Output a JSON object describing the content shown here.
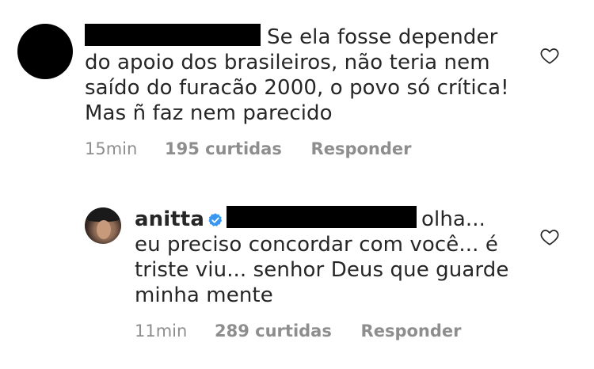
{
  "comments": [
    {
      "text_line1": "Se ela fosse depender",
      "text_line2": "do apoio dos brasileiros, não teria nem",
      "text_line3": "saído do furacão 2000, o povo só crítica!",
      "text_line4": "Mas ñ faz nem parecido",
      "time": "15min",
      "likes": "195 curtidas",
      "reply_label": "Responder",
      "avatar_icon": "redacted-avatar",
      "like_icon": "heart-outline-icon"
    },
    {
      "username": "anitta",
      "verified_icon": "verified-badge-icon",
      "text_line1": "olha...",
      "text_line2": "eu preciso concordar com você... é",
      "text_line3": "triste viu... senhor Deus que guarde",
      "text_line4": "minha mente",
      "time": "11min",
      "likes": "289 curtidas",
      "reply_label": "Responder",
      "avatar_icon": "profile-photo",
      "like_icon": "heart-outline-icon"
    }
  ],
  "colors": {
    "text": "#262626",
    "meta": "#8e8e8e",
    "verified": "#3897f0",
    "redaction": "#000000"
  }
}
